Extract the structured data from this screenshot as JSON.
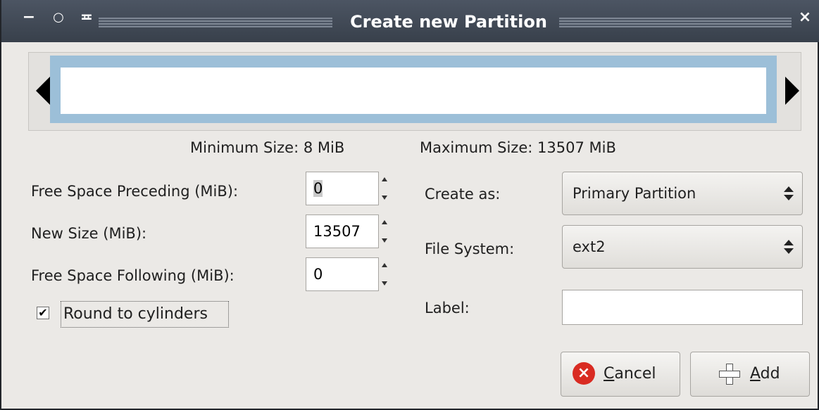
{
  "window": {
    "title": "Create new Partition",
    "buttons": {
      "minimize": "−",
      "maximize": "○",
      "shade": "≖",
      "close": "×"
    }
  },
  "sizes": {
    "minimum": "Minimum Size: 8 MiB",
    "maximum": "Maximum Size: 13507 MiB"
  },
  "fields": {
    "free_preceding": {
      "label": "Free Space Preceding (MiB):",
      "value": "0"
    },
    "new_size": {
      "label": "New Size (MiB):",
      "value": "13507"
    },
    "free_following": {
      "label": "Free Space Following (MiB):",
      "value": "0"
    },
    "round_cylinders": {
      "label": "Round to cylinders",
      "checked": true,
      "check": "✔"
    }
  },
  "right": {
    "create_as": {
      "label": "Create as:",
      "value": "Primary Partition"
    },
    "file_system": {
      "label": "File System:",
      "value": "ext2"
    },
    "label_field": {
      "label": "Label:",
      "value": ""
    }
  },
  "buttons": {
    "cancel_prefix": "",
    "cancel_mnemonic": "C",
    "cancel_rest": "ancel",
    "add_mnemonic": "A",
    "add_rest": "dd"
  },
  "colors": {
    "partition_fill": "#9cbfd8",
    "titlebar": "#38404b",
    "cancel_icon": "#d92b22"
  }
}
